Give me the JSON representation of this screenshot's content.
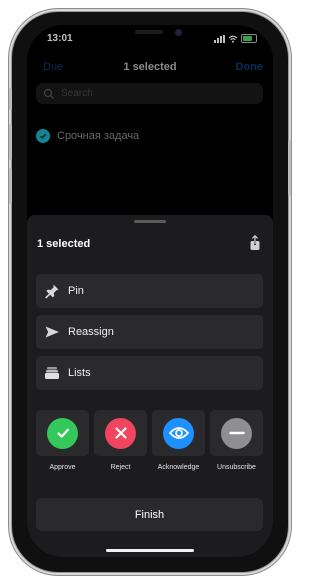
{
  "status_bar": {
    "time": "13:01"
  },
  "nav": {
    "left": "Due",
    "title": "1 selected",
    "right": "Done"
  },
  "search": {
    "placeholder": "Search"
  },
  "task": {
    "title": "Срочная задача",
    "checked": true
  },
  "sheet": {
    "title": "1 selected",
    "rows": [
      {
        "label": "Pin",
        "icon": "pin-icon"
      },
      {
        "label": "Reassign",
        "icon": "send-icon"
      },
      {
        "label": "Lists",
        "icon": "stack-icon"
      }
    ],
    "actions": [
      {
        "label": "Approve",
        "icon": "checkmark-icon",
        "color": "#34c759"
      },
      {
        "label": "Reject",
        "icon": "close-icon",
        "color": "#f0445f"
      },
      {
        "label": "Acknowledge",
        "icon": "eye-icon",
        "color": "#1e90ff"
      },
      {
        "label": "Unsubscribe",
        "icon": "minus-icon",
        "color": "#8e8e93"
      }
    ],
    "finish_label": "Finish"
  }
}
